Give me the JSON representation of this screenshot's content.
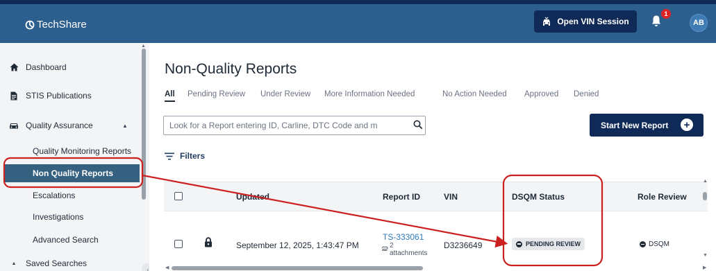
{
  "app": {
    "logo_text": "TechShare"
  },
  "header": {
    "vin_button_label": "Open VIN Session",
    "notification_count": "1",
    "avatar_initials": "AB"
  },
  "sidebar": {
    "items": [
      {
        "label": "Dashboard",
        "icon": "home-icon"
      },
      {
        "label": "STIS Publications",
        "icon": "document-icon"
      },
      {
        "label": "Quality Assurance",
        "icon": "car-icon",
        "expanded": true
      }
    ],
    "sub_items": [
      {
        "label": "Quality Monitoring Reports"
      },
      {
        "label": "Non Quality Reports",
        "active": true
      },
      {
        "label": "Escalations"
      },
      {
        "label": "Investigations"
      },
      {
        "label": "Advanced Search"
      }
    ],
    "saved_searches_label": "Saved Searches"
  },
  "main": {
    "title": "Non-Quality Reports",
    "tabs": [
      {
        "label": "All",
        "active": true
      },
      {
        "label": "Pending Review"
      },
      {
        "label": "Under Review"
      },
      {
        "label": "More Information Needed"
      },
      {
        "label": "No Action Needed"
      },
      {
        "label": "Approved"
      },
      {
        "label": "Denied"
      }
    ],
    "search_placeholder": "Look for a Report entering ID, Carline, DTC Code and m",
    "start_button_label": "Start New Report",
    "filters_label": "Filters"
  },
  "table": {
    "columns": [
      "Updated",
      "Report ID",
      "VIN",
      "DSQM Status",
      "Role Review"
    ],
    "rows": [
      {
        "updated": "September 12, 2025, 1:43:47 PM",
        "report_id": "TS-333061",
        "attachments_count": "2",
        "attachments_label": "attachments",
        "vin": "D3236649",
        "dsqm_status": "PENDING REVIEW",
        "role_review": "DSQM"
      }
    ]
  },
  "colors": {
    "header_bg": "#2d5f8e",
    "header_top": "#0f2a57",
    "primary_button": "#0f2a57",
    "active_nav": "#35607f",
    "annotation_red": "#cc1f1f",
    "link": "#2f7ab8"
  }
}
